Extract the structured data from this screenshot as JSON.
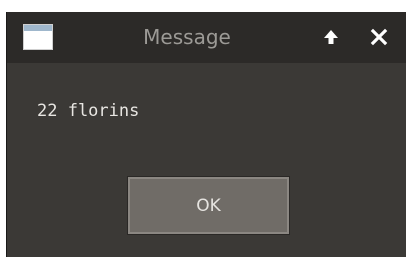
{
  "window": {
    "title": "Message"
  },
  "titlebar": {
    "icons": [
      "window-app-icon",
      "maximize-arrow-icon",
      "close-icon"
    ]
  },
  "message": {
    "text": "22 florins"
  },
  "buttons": {
    "ok_label": "OK"
  },
  "colors": {
    "background": "#3b3936",
    "titlebar": "#2c2a28",
    "title_text": "#9c9a96",
    "button": "#706c67"
  }
}
